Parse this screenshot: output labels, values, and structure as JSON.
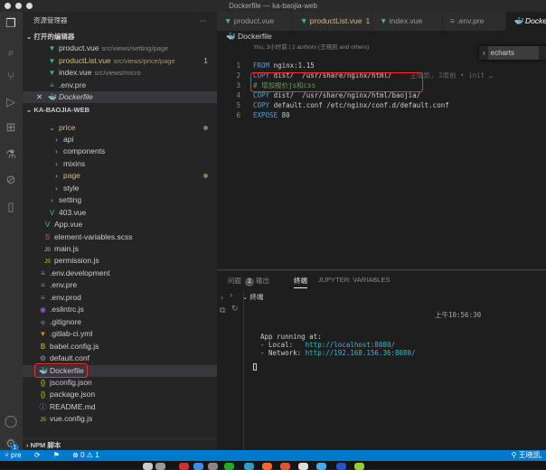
{
  "window": {
    "title": "Dockerfile — ka-baojia-web"
  },
  "sidebar": {
    "title": "资源管理器",
    "more": "···",
    "open_editors_header": "打开的编辑器",
    "open_editors": [
      {
        "name": "product.vue",
        "path": "src/views/setting/page",
        "icon": "vue-icon"
      },
      {
        "name": "productList.vue",
        "path": "src/views/price/page",
        "badge": "1",
        "icon": "vue-icon"
      },
      {
        "name": "index.vue",
        "path": "src/views/micro",
        "icon": "vue-icon"
      },
      {
        "name": ".env.pre",
        "path": "",
        "icon": "file-lines-icon"
      },
      {
        "name": "Dockerfile",
        "path": "",
        "icon": "docker-icon"
      }
    ],
    "project_header": "KA-BAOJIA-WEB",
    "tree": [
      {
        "name": "price",
        "depth": 1,
        "folder": "open",
        "modified": true
      },
      {
        "name": "api",
        "depth": 2,
        "folder": "closed"
      },
      {
        "name": "components",
        "depth": 2,
        "folder": "closed"
      },
      {
        "name": "mixins",
        "depth": 2,
        "folder": "closed"
      },
      {
        "name": "page",
        "depth": 2,
        "folder": "closed",
        "modified": true
      },
      {
        "name": "style",
        "depth": 2,
        "folder": "closed"
      },
      {
        "name": "setting",
        "depth": 1,
        "folder": "closed"
      },
      {
        "name": "403.vue",
        "depth": 1,
        "icon": "V"
      },
      {
        "name": "App.vue",
        "depth": 0,
        "icon": "V"
      },
      {
        "name": "element-variables.scss",
        "depth": 0,
        "icon": "S"
      },
      {
        "name": "main.js",
        "depth": 0,
        "icon": "JS"
      },
      {
        "name": "permission.js",
        "depth": 0,
        "icon": "JS"
      },
      {
        "name": ".env.development",
        "depth": -1,
        "icon": "≡"
      },
      {
        "name": ".env.pre",
        "depth": -1,
        "icon": "≡"
      },
      {
        "name": ".env.prod",
        "depth": -1,
        "icon": "≡"
      },
      {
        "name": ".eslintrc.js",
        "depth": -1,
        "icon": "◉"
      },
      {
        "name": ".gitignore",
        "depth": -1,
        "icon": "◆"
      },
      {
        "name": ".gitlab-ci.yml",
        "depth": -1,
        "icon": "▼"
      },
      {
        "name": "babel.config.js",
        "depth": -1,
        "icon": "B"
      },
      {
        "name": "default.conf",
        "depth": -1,
        "icon": "⚙"
      },
      {
        "name": "Dockerfile",
        "depth": -1,
        "icon": "🐳",
        "selected": true
      },
      {
        "name": "jsconfig.json",
        "depth": -1,
        "icon": "{}"
      },
      {
        "name": "package.json",
        "depth": -1,
        "icon": "{}"
      },
      {
        "name": "README.md",
        "depth": -1,
        "icon": "ⓘ"
      },
      {
        "name": "vue.config.js",
        "depth": -1,
        "icon": "JS"
      }
    ],
    "npm_header": "NPM 脚本"
  },
  "tabs": [
    {
      "label": "product.vue"
    },
    {
      "label": "productList.vue",
      "badge": "1"
    },
    {
      "label": "index.vue"
    },
    {
      "label": ".env.pre"
    },
    {
      "label": "Dockerfile",
      "active": true
    }
  ],
  "breadcrumb": "Dockerfile",
  "editor": {
    "blame_header": "You, 3小时前 | 2 authors (王晓凯 and others)",
    "lines": [
      {
        "n": "1",
        "kw": "FROM",
        "rest": " nginx:1.15"
      },
      {
        "n": "2",
        "kw": "COPY",
        "rest": " dist/  /usr/share/nginx/html/",
        "blame": "王晓凯, 3周前 • init …"
      },
      {
        "n": "3",
        "comment": "# 增加报价js和css"
      },
      {
        "n": "4",
        "kw": "COPY",
        "rest": " dist/  /usr/share/nginx/html/baojia/"
      },
      {
        "n": "5",
        "kw": "COPY",
        "rest": " default.conf /etc/nginx/conf.d/default.conf"
      },
      {
        "n": "6",
        "kw": "EXPOSE",
        "num": " 80"
      }
    ]
  },
  "find": {
    "value": "echarts"
  },
  "panel": {
    "tabs": [
      {
        "label": "问题",
        "badge": "1"
      },
      {
        "label": "输出"
      },
      {
        "label": "终端",
        "active": true
      },
      {
        "label": "JUPYTER: VARIABLES"
      }
    ],
    "terminal_header": "终端",
    "time": "上午10:56:30",
    "output": {
      "line1": "App running at:",
      "local_label": "- Local:   ",
      "local_url": "http://localhost:8080/",
      "network_label": "- Network: ",
      "network_url": "http://192.168.156.36:8080/"
    }
  },
  "status": {
    "branch": "pre",
    "errors": "0",
    "warnings": "1",
    "author": "王晓凯,",
    "settings_badge": "1"
  },
  "colors": {
    "status_bar": "#007acc",
    "modified": "#d7ba7d",
    "vue": "#41b883",
    "highlight": "#e8322a"
  }
}
